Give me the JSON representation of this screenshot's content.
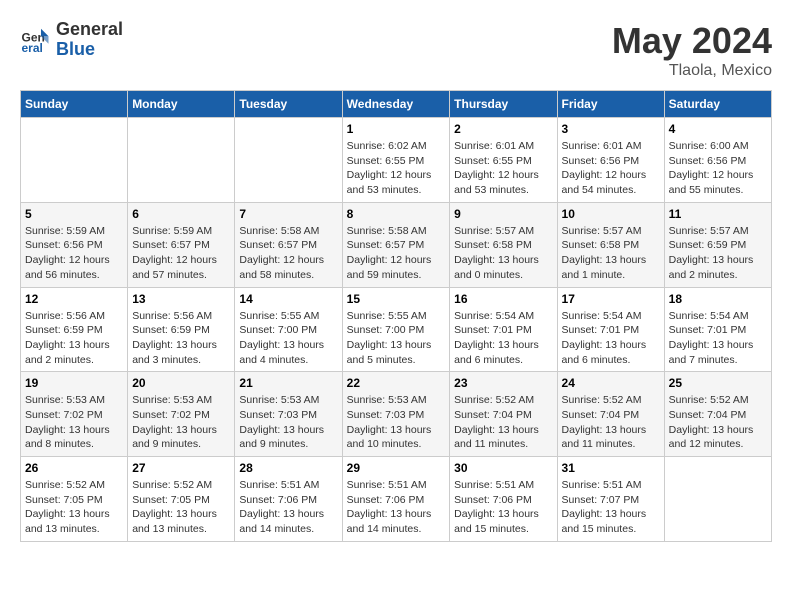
{
  "header": {
    "logo_general": "General",
    "logo_blue": "Blue",
    "month_title": "May 2024",
    "location": "Tlaola, Mexico"
  },
  "days_of_week": [
    "Sunday",
    "Monday",
    "Tuesday",
    "Wednesday",
    "Thursday",
    "Friday",
    "Saturday"
  ],
  "weeks": [
    [
      {
        "day": "",
        "sunrise": "",
        "sunset": "",
        "daylight": ""
      },
      {
        "day": "",
        "sunrise": "",
        "sunset": "",
        "daylight": ""
      },
      {
        "day": "",
        "sunrise": "",
        "sunset": "",
        "daylight": ""
      },
      {
        "day": "1",
        "sunrise": "Sunrise: 6:02 AM",
        "sunset": "Sunset: 6:55 PM",
        "daylight": "Daylight: 12 hours and 53 minutes."
      },
      {
        "day": "2",
        "sunrise": "Sunrise: 6:01 AM",
        "sunset": "Sunset: 6:55 PM",
        "daylight": "Daylight: 12 hours and 53 minutes."
      },
      {
        "day": "3",
        "sunrise": "Sunrise: 6:01 AM",
        "sunset": "Sunset: 6:56 PM",
        "daylight": "Daylight: 12 hours and 54 minutes."
      },
      {
        "day": "4",
        "sunrise": "Sunrise: 6:00 AM",
        "sunset": "Sunset: 6:56 PM",
        "daylight": "Daylight: 12 hours and 55 minutes."
      }
    ],
    [
      {
        "day": "5",
        "sunrise": "Sunrise: 5:59 AM",
        "sunset": "Sunset: 6:56 PM",
        "daylight": "Daylight: 12 hours and 56 minutes."
      },
      {
        "day": "6",
        "sunrise": "Sunrise: 5:59 AM",
        "sunset": "Sunset: 6:57 PM",
        "daylight": "Daylight: 12 hours and 57 minutes."
      },
      {
        "day": "7",
        "sunrise": "Sunrise: 5:58 AM",
        "sunset": "Sunset: 6:57 PM",
        "daylight": "Daylight: 12 hours and 58 minutes."
      },
      {
        "day": "8",
        "sunrise": "Sunrise: 5:58 AM",
        "sunset": "Sunset: 6:57 PM",
        "daylight": "Daylight: 12 hours and 59 minutes."
      },
      {
        "day": "9",
        "sunrise": "Sunrise: 5:57 AM",
        "sunset": "Sunset: 6:58 PM",
        "daylight": "Daylight: 13 hours and 0 minutes."
      },
      {
        "day": "10",
        "sunrise": "Sunrise: 5:57 AM",
        "sunset": "Sunset: 6:58 PM",
        "daylight": "Daylight: 13 hours and 1 minute."
      },
      {
        "day": "11",
        "sunrise": "Sunrise: 5:57 AM",
        "sunset": "Sunset: 6:59 PM",
        "daylight": "Daylight: 13 hours and 2 minutes."
      }
    ],
    [
      {
        "day": "12",
        "sunrise": "Sunrise: 5:56 AM",
        "sunset": "Sunset: 6:59 PM",
        "daylight": "Daylight: 13 hours and 2 minutes."
      },
      {
        "day": "13",
        "sunrise": "Sunrise: 5:56 AM",
        "sunset": "Sunset: 6:59 PM",
        "daylight": "Daylight: 13 hours and 3 minutes."
      },
      {
        "day": "14",
        "sunrise": "Sunrise: 5:55 AM",
        "sunset": "Sunset: 7:00 PM",
        "daylight": "Daylight: 13 hours and 4 minutes."
      },
      {
        "day": "15",
        "sunrise": "Sunrise: 5:55 AM",
        "sunset": "Sunset: 7:00 PM",
        "daylight": "Daylight: 13 hours and 5 minutes."
      },
      {
        "day": "16",
        "sunrise": "Sunrise: 5:54 AM",
        "sunset": "Sunset: 7:01 PM",
        "daylight": "Daylight: 13 hours and 6 minutes."
      },
      {
        "day": "17",
        "sunrise": "Sunrise: 5:54 AM",
        "sunset": "Sunset: 7:01 PM",
        "daylight": "Daylight: 13 hours and 6 minutes."
      },
      {
        "day": "18",
        "sunrise": "Sunrise: 5:54 AM",
        "sunset": "Sunset: 7:01 PM",
        "daylight": "Daylight: 13 hours and 7 minutes."
      }
    ],
    [
      {
        "day": "19",
        "sunrise": "Sunrise: 5:53 AM",
        "sunset": "Sunset: 7:02 PM",
        "daylight": "Daylight: 13 hours and 8 minutes."
      },
      {
        "day": "20",
        "sunrise": "Sunrise: 5:53 AM",
        "sunset": "Sunset: 7:02 PM",
        "daylight": "Daylight: 13 hours and 9 minutes."
      },
      {
        "day": "21",
        "sunrise": "Sunrise: 5:53 AM",
        "sunset": "Sunset: 7:03 PM",
        "daylight": "Daylight: 13 hours and 9 minutes."
      },
      {
        "day": "22",
        "sunrise": "Sunrise: 5:53 AM",
        "sunset": "Sunset: 7:03 PM",
        "daylight": "Daylight: 13 hours and 10 minutes."
      },
      {
        "day": "23",
        "sunrise": "Sunrise: 5:52 AM",
        "sunset": "Sunset: 7:04 PM",
        "daylight": "Daylight: 13 hours and 11 minutes."
      },
      {
        "day": "24",
        "sunrise": "Sunrise: 5:52 AM",
        "sunset": "Sunset: 7:04 PM",
        "daylight": "Daylight: 13 hours and 11 minutes."
      },
      {
        "day": "25",
        "sunrise": "Sunrise: 5:52 AM",
        "sunset": "Sunset: 7:04 PM",
        "daylight": "Daylight: 13 hours and 12 minutes."
      }
    ],
    [
      {
        "day": "26",
        "sunrise": "Sunrise: 5:52 AM",
        "sunset": "Sunset: 7:05 PM",
        "daylight": "Daylight: 13 hours and 13 minutes."
      },
      {
        "day": "27",
        "sunrise": "Sunrise: 5:52 AM",
        "sunset": "Sunset: 7:05 PM",
        "daylight": "Daylight: 13 hours and 13 minutes."
      },
      {
        "day": "28",
        "sunrise": "Sunrise: 5:51 AM",
        "sunset": "Sunset: 7:06 PM",
        "daylight": "Daylight: 13 hours and 14 minutes."
      },
      {
        "day": "29",
        "sunrise": "Sunrise: 5:51 AM",
        "sunset": "Sunset: 7:06 PM",
        "daylight": "Daylight: 13 hours and 14 minutes."
      },
      {
        "day": "30",
        "sunrise": "Sunrise: 5:51 AM",
        "sunset": "Sunset: 7:06 PM",
        "daylight": "Daylight: 13 hours and 15 minutes."
      },
      {
        "day": "31",
        "sunrise": "Sunrise: 5:51 AM",
        "sunset": "Sunset: 7:07 PM",
        "daylight": "Daylight: 13 hours and 15 minutes."
      },
      {
        "day": "",
        "sunrise": "",
        "sunset": "",
        "daylight": ""
      }
    ]
  ]
}
